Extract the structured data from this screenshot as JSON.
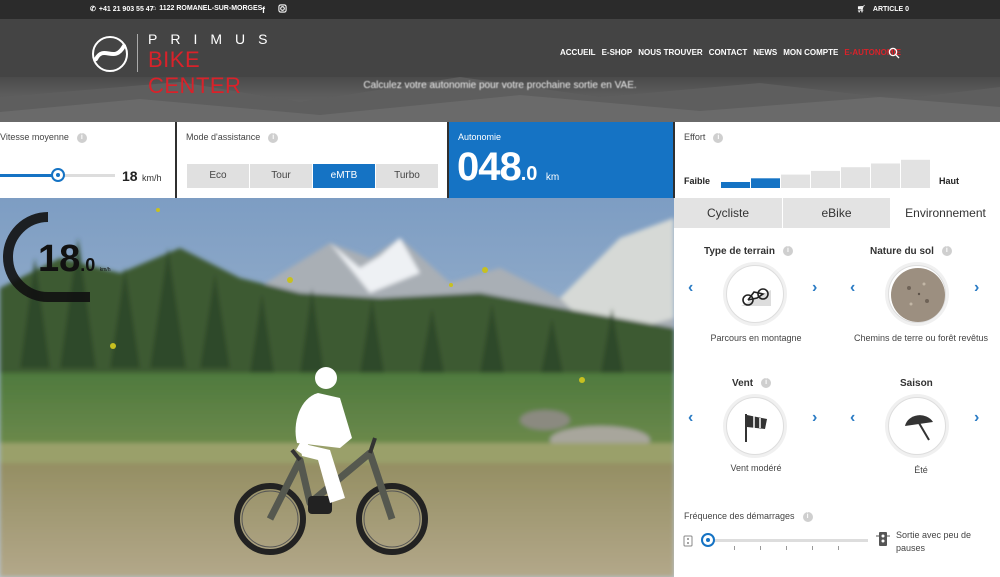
{
  "topbar": {
    "phone": "+41 21 903 55 47",
    "address": "1122 ROMANEL-SUR-MORGES",
    "cart": "ARTICLE 0"
  },
  "brand": {
    "line1": "PRIMUS",
    "line2": "BIKE CENTER"
  },
  "nav": [
    {
      "label": "ACCUEIL",
      "active": false
    },
    {
      "label": "E-SHOP",
      "active": false
    },
    {
      "label": "NOUS TROUVER",
      "active": false
    },
    {
      "label": "CONTACT",
      "active": false
    },
    {
      "label": "NEWS",
      "active": false
    },
    {
      "label": "MON COMPTE",
      "active": false
    },
    {
      "label": "E-AUTONOMIE",
      "active": true
    }
  ],
  "hero": {
    "subtitle": "Calculez votre autonomie pour votre prochaine sortie en VAE."
  },
  "speed_panel": {
    "label": "Vitesse moyenne",
    "value": "18",
    "unit": "km/h",
    "slider_fraction": 0.5
  },
  "mode_panel": {
    "label": "Mode d'assistance",
    "modes": [
      "Eco",
      "Tour",
      "eMTB",
      "Turbo"
    ],
    "selected": "eMTB"
  },
  "autonomy_panel": {
    "label": "Autonomie",
    "value": "048",
    "decimal": ".0",
    "unit": "km"
  },
  "effort_panel": {
    "label": "Effort",
    "low": "Faible",
    "high": "Haut",
    "level": 2,
    "levels": 7
  },
  "gauge": {
    "value": "18",
    "decimal": ".0",
    "unit": "km/h"
  },
  "tabs": [
    "Cycliste",
    "eBike",
    "Environnement"
  ],
  "active_tab": "Environnement",
  "env": {
    "terrain": {
      "title": "Type de terrain",
      "caption": "Parcours en montagne"
    },
    "sol": {
      "title": "Nature du sol",
      "caption": "Chemins de terre ou forêt revêtus"
    },
    "vent": {
      "title": "Vent",
      "caption": "Vent modéré"
    },
    "saison": {
      "title": "Saison",
      "caption": "Été"
    }
  },
  "frequency": {
    "label": "Fréquence des démarrages",
    "right_label": "Sortie avec peu de pauses",
    "slider_fraction": 0.0
  },
  "colors": {
    "accent": "#1573c4",
    "nav_active": "#d9222a",
    "header": "#444444"
  }
}
